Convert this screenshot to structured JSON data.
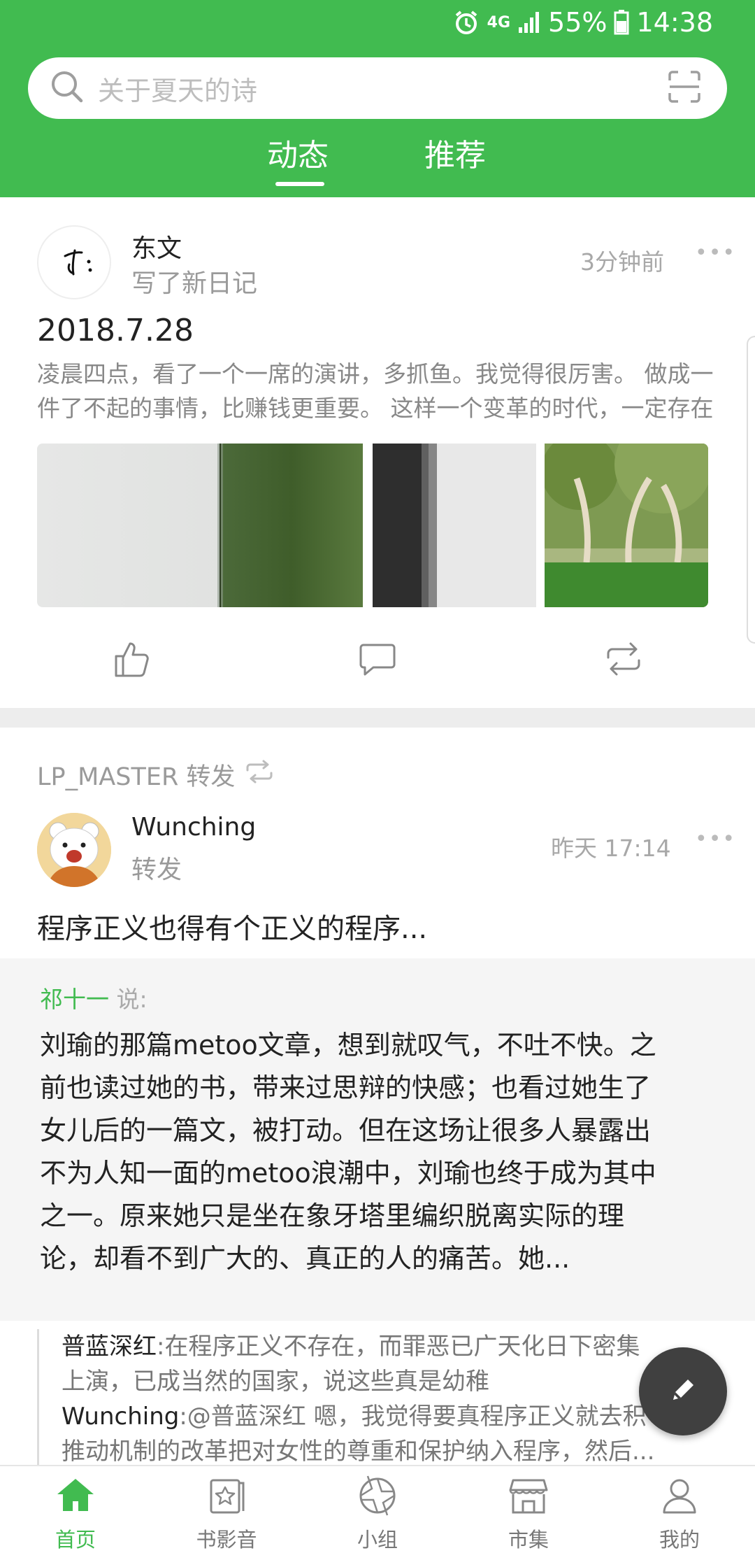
{
  "status_bar": {
    "signal": "4G",
    "battery": "55%",
    "time": "14:38"
  },
  "search": {
    "placeholder": "关于夏天的诗"
  },
  "tabs": [
    {
      "label": "动态",
      "active": true
    },
    {
      "label": "推荐",
      "active": false
    }
  ],
  "post1": {
    "author": "东文",
    "action": "写了新日记",
    "time": "3分钟前",
    "more": "•••",
    "title": "2018.7.28",
    "excerpt_line1": "凌晨四点，看了一个一席的演讲，多抓鱼。我觉得很厉害。 做成一",
    "excerpt_line2": "件了不起的事情，比赚钱更重要。 这样一个变革的时代，一定存在"
  },
  "post2": {
    "repost_by": "LP_MASTER 转发",
    "author": "Wunching",
    "action": "转发",
    "time": "昨天 17:14",
    "more": "•••",
    "text": "程序正义也得有个正义的程序...",
    "quote": {
      "author": "祁十一",
      "said": "说:",
      "lines": [
        "刘瑜的那篇metoo文章，想到就叹气，不吐不快。之",
        "前也读过她的书，带来过思辩的快感；也看过她生了",
        "女儿后的一篇文，被打动。但在这场让很多人暴露出",
        "不为人知一面的metoo浪潮中，刘瑜也终于成为其中",
        "之一。原来她只是坐在象牙塔里编织脱离实际的理",
        "论，却看不到广大的、真正的人的痛苦。她..."
      ]
    },
    "comments": [
      {
        "name": "普蓝深红",
        "text": ":在程序正义不存在，而罪恶已广天化日下密集"
      },
      {
        "name": "",
        "text": "上演，已成当然的国家，说这些真是幼稚"
      },
      {
        "name": "Wunching",
        "text": ":@普蓝深红 嗯，我觉得要真程序正义就去积"
      },
      {
        "name": "",
        "text": "推动机制的改革把对女性的尊重和保护纳入程序，然后..."
      }
    ]
  },
  "bottom_nav": [
    {
      "label": "首页",
      "icon": "home-icon",
      "active": true
    },
    {
      "label": "书影音",
      "icon": "book-movie-music-icon",
      "active": false
    },
    {
      "label": "小组",
      "icon": "group-icon",
      "active": false
    },
    {
      "label": "市集",
      "icon": "market-icon",
      "active": false
    },
    {
      "label": "我的",
      "icon": "profile-icon",
      "active": false
    }
  ],
  "colors": {
    "brand_green": "#41bb50",
    "fab": "#404040"
  }
}
